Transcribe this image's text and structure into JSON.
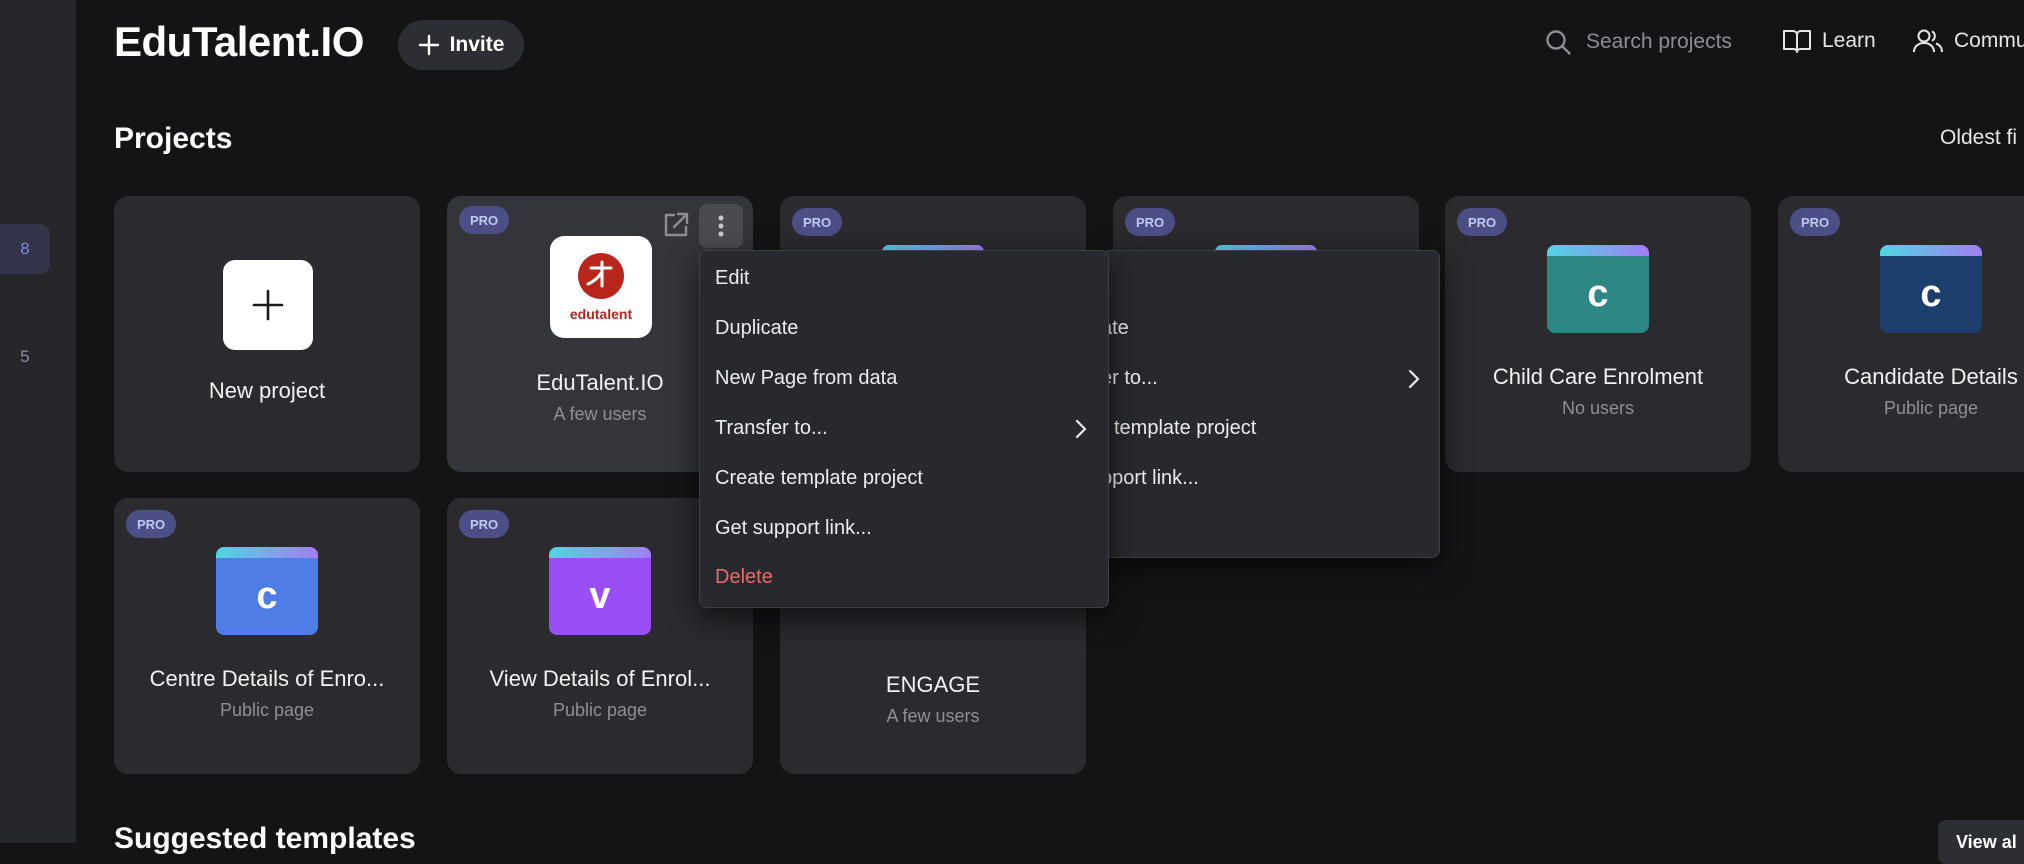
{
  "sidebar": {
    "items": [
      {
        "label": "8",
        "active": true
      },
      {
        "label": "5",
        "active": false
      }
    ]
  },
  "header": {
    "title": "EduTalent.IO",
    "invite_label": "Invite",
    "search_placeholder": "Search projects",
    "learn_label": "Learn",
    "community_label": "Commu"
  },
  "projects": {
    "title": "Projects",
    "sort_label": "Oldest fi",
    "new_project_label": "New project",
    "pro_badge": "PRO",
    "cards": [
      {
        "name": "EduTalent.IO",
        "sub": "A few users",
        "logo_text": "edutalent"
      },
      {
        "name": "Child Care Enrolment",
        "sub": "No users",
        "icon_letter": "c",
        "icon_color": "#2e8784"
      },
      {
        "name": "Candidate Details",
        "sub": "Public page",
        "icon_letter": "c",
        "icon_color": "#1c3f6e"
      },
      {
        "name": "Centre Details of Enro...",
        "sub": "Public page",
        "icon_letter": "c",
        "icon_color": "#4f7de6"
      },
      {
        "name": "View Details of Enrol...",
        "sub": "Public page",
        "icon_letter": "v",
        "icon_color": "#9a4ef5"
      },
      {
        "name": "ENGAGE",
        "sub": "A few users",
        "logo_color": "#b8341b"
      }
    ]
  },
  "context_menu": {
    "items": [
      {
        "label": "Edit"
      },
      {
        "label": "Duplicate"
      },
      {
        "label": "New Page from data"
      },
      {
        "label": "Transfer to..."
      },
      {
        "label": "Create template project"
      },
      {
        "label": "Get support link..."
      },
      {
        "label": "Delete"
      }
    ]
  },
  "background_menu": {
    "items": [
      {
        "label": "ate"
      },
      {
        "label": "er to..."
      },
      {
        "label": "template project"
      },
      {
        "label": "pport link..."
      }
    ]
  },
  "suggested": {
    "title": "Suggested templates",
    "view_all_label": "View al"
  },
  "colors": {
    "background": "#141416",
    "card": "#2a2a2f",
    "pro_badge": "#4c4f85",
    "danger": "#ea6a6a"
  }
}
